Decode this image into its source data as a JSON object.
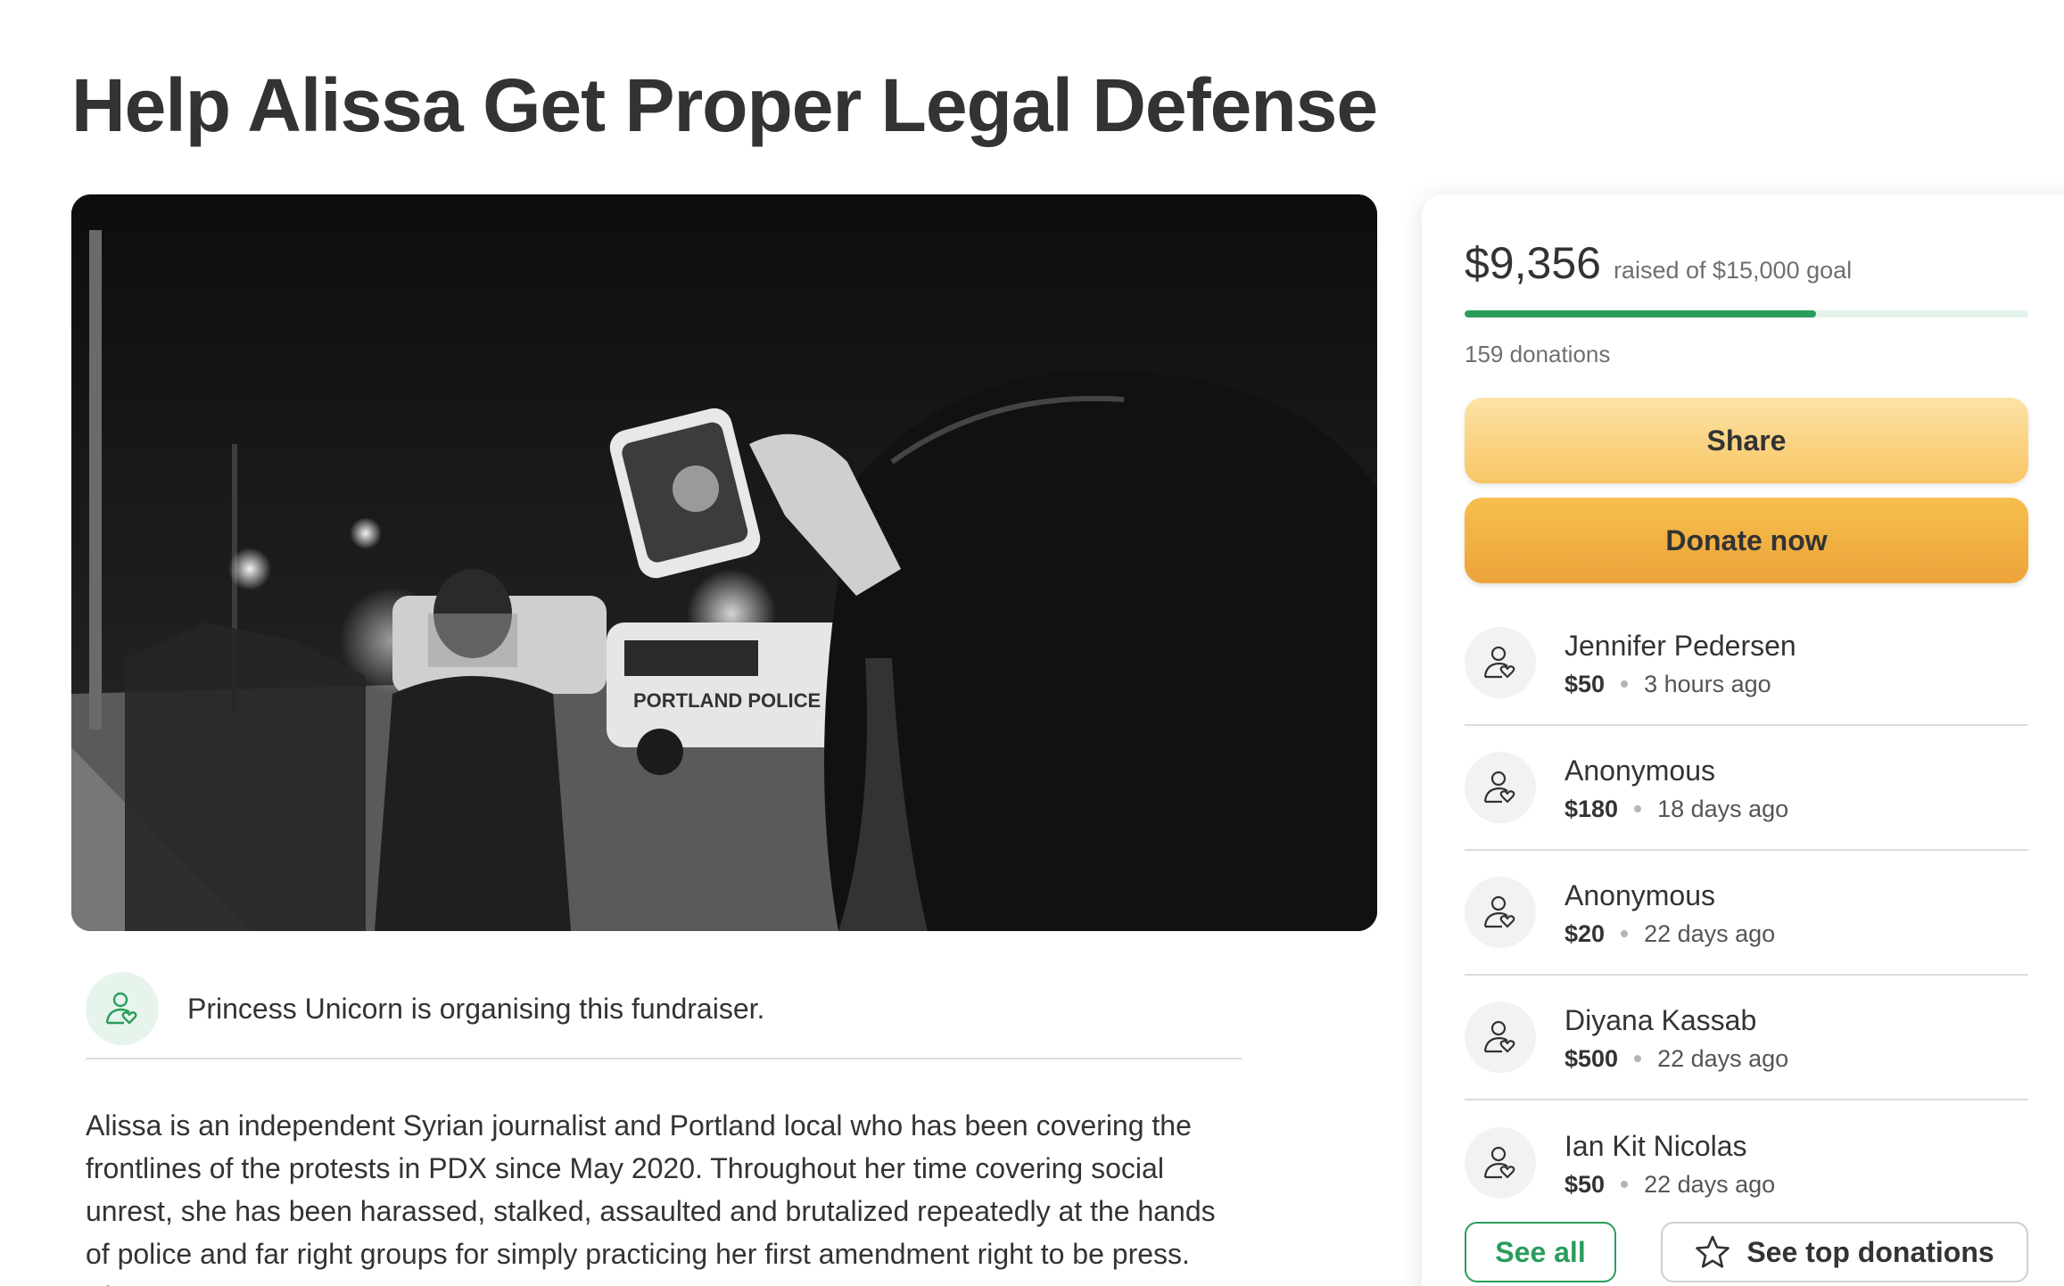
{
  "campaign": {
    "title": "Help Alissa Get Proper Legal Defense",
    "organiser_text": "Princess Unicorn is organising this fundraiser.",
    "story": "Alissa is an independent Syrian journalist and Portland local who has been covering the frontlines of the protests in PDX since May 2020. Throughout her time covering social unrest, she has been harassed, stalked, assaulted and brutalized repeatedly at the hands of police and far right groups for simply practicing her first amendment right to be press. She"
  },
  "hero": {
    "police_car_text": "PORTLAND POLICE"
  },
  "summary": {
    "raised": "$9,356",
    "goal_text": "raised of $15,000 goal",
    "progress_fraction": 0.624,
    "donation_count": "159 donations"
  },
  "actions": {
    "share_label": "Share",
    "donate_label": "Donate now",
    "see_all_label": "See all",
    "see_top_label": "See top donations"
  },
  "donations": [
    {
      "name": "Jennifer Pedersen",
      "amount": "$50",
      "time": "3 hours ago"
    },
    {
      "name": "Anonymous",
      "amount": "$180",
      "time": "18 days ago"
    },
    {
      "name": "Anonymous",
      "amount": "$20",
      "time": "22 days ago"
    },
    {
      "name": "Diyana Kassab",
      "amount": "$500",
      "time": "22 days ago"
    },
    {
      "name": "Ian Kit Nicolas",
      "amount": "$50",
      "time": "22 days ago"
    }
  ],
  "colors": {
    "accent_green": "#2a9d5c",
    "share_button": "#f8c564",
    "donate_button": "#eda33a"
  },
  "icons": {
    "donor_avatar": "person-heart-icon",
    "see_top": "star-icon"
  }
}
